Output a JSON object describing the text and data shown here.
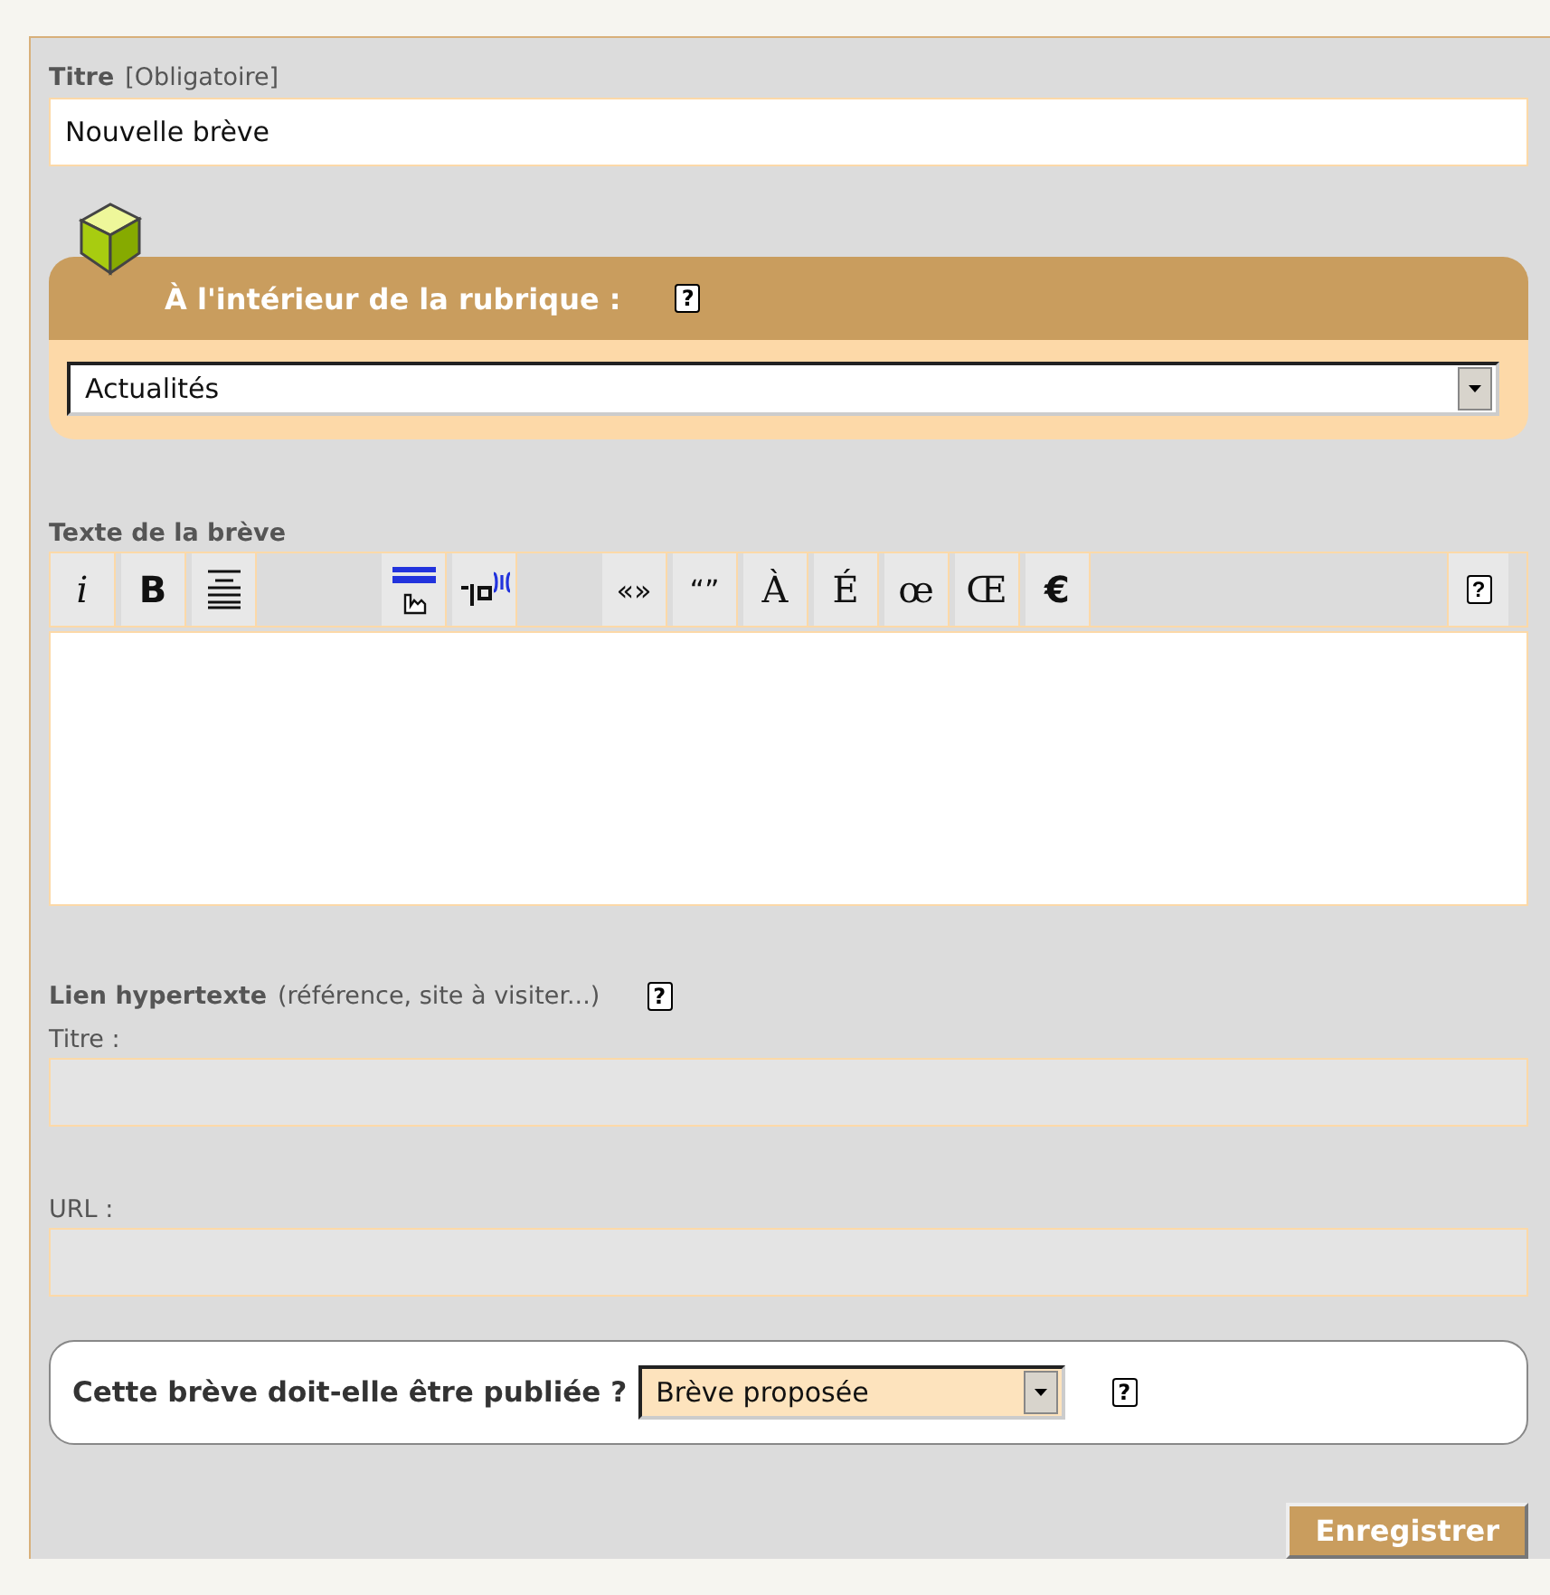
{
  "title_field": {
    "label": "Titre",
    "note": "[Obligatoire]",
    "value": "Nouvelle brève"
  },
  "rubrique": {
    "heading": "À l'intérieur de la rubrique :",
    "help": "?",
    "selected_option": "Actualités"
  },
  "text_editor": {
    "label": "Texte de la brève",
    "help": "?",
    "toolbar_groups": [
      [
        {
          "kind": "char",
          "text": "i"
        },
        {
          "kind": "char",
          "text": "B"
        },
        {
          "kind": "icon"
        }
      ],
      [
        {
          "kind": "icon"
        },
        {
          "kind": "icon"
        }
      ],
      [
        {
          "kind": "char",
          "text": "«»"
        },
        {
          "kind": "char",
          "text": "“”"
        },
        {
          "kind": "char",
          "text": "À"
        },
        {
          "kind": "char",
          "text": "É"
        },
        {
          "kind": "char",
          "text": "œ"
        },
        {
          "kind": "char",
          "text": "Œ"
        },
        {
          "kind": "char",
          "text": "€"
        }
      ]
    ]
  },
  "hyperlink": {
    "label": "Lien hypertexte",
    "note": "(référence, site à visiter...)",
    "help": "?",
    "title_label": "Titre :",
    "url_label": "URL :"
  },
  "publication": {
    "question": "Cette brève doit-elle être publiée ?",
    "selected_option": "Brève proposée",
    "help": "?"
  },
  "submit": "Enregistrer"
}
